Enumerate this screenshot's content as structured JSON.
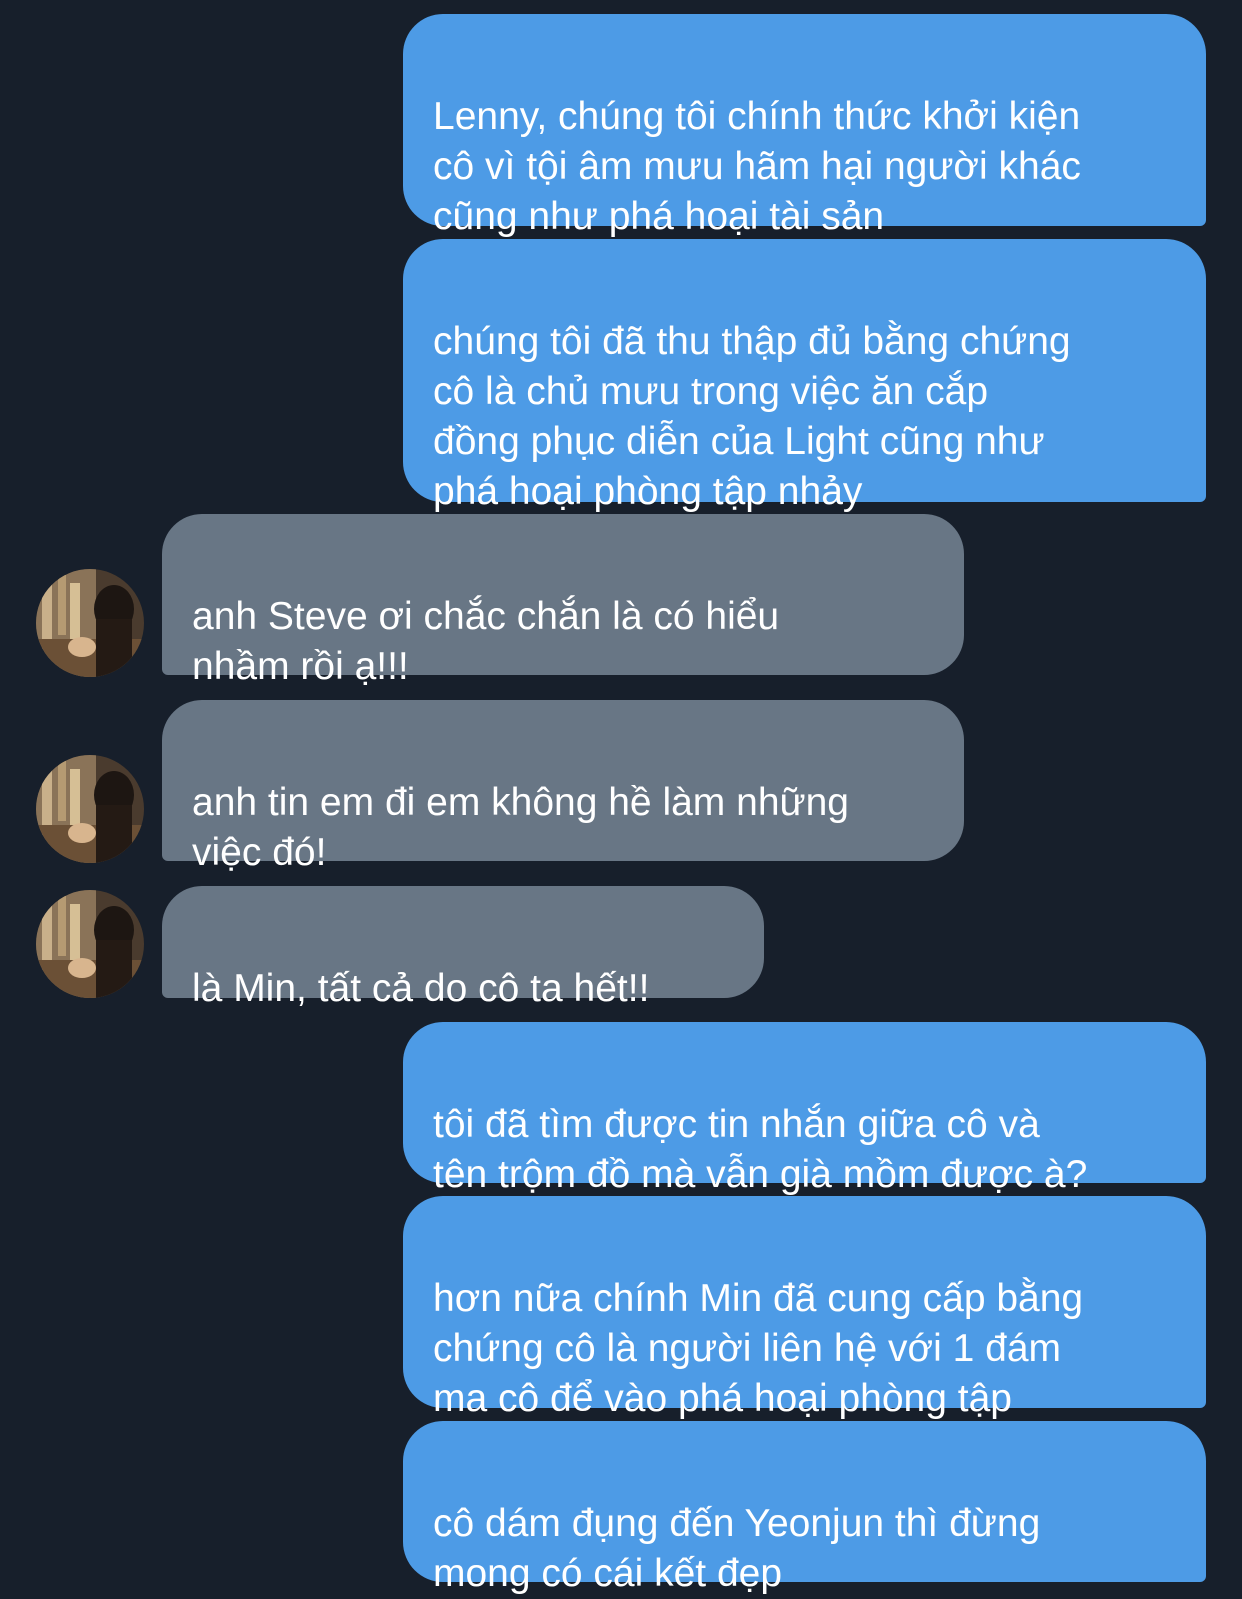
{
  "theme": {
    "background": "#171f2b",
    "outgoing_bubble": "#4d9be6",
    "incoming_bubble": "#687685",
    "text": "#ffffff"
  },
  "messages": [
    {
      "direction": "outgoing",
      "text": "Lenny, chúng tôi chính thức khởi kiện\ncô vì tội âm mưu hãm hại người khác\ncũng như phá hoại tài sản"
    },
    {
      "direction": "outgoing",
      "text": "chúng tôi đã thu thập đủ bằng chứng\ncô là chủ mưu trong việc ăn cắp\nđồng phục diễn của Light cũng như\nphá hoại phòng tập nhảy"
    },
    {
      "direction": "incoming",
      "text": "anh Steve ơi chắc chắn là có hiểu\nnhầm rồi ạ!!!",
      "avatar": "contact-avatar-photo"
    },
    {
      "direction": "incoming",
      "text": "anh tin em đi em không hề làm những\nviệc đó!",
      "avatar": "contact-avatar-photo"
    },
    {
      "direction": "incoming",
      "text": "là Min, tất cả do cô ta hết!!",
      "avatar": "contact-avatar-photo"
    },
    {
      "direction": "outgoing",
      "text": "tôi đã tìm được tin nhắn giữa cô và\ntên trộm đồ mà vẫn già mồm được à?"
    },
    {
      "direction": "outgoing",
      "text": "hơn nữa chính Min đã cung cấp bằng\nchứng cô là người liên hệ với 1 đám\nma cô để vào phá hoại phòng tập"
    },
    {
      "direction": "outgoing",
      "text": "cô dám đụng đến Yeonjun thì đừng\nmong có cái kết đẹp"
    }
  ]
}
